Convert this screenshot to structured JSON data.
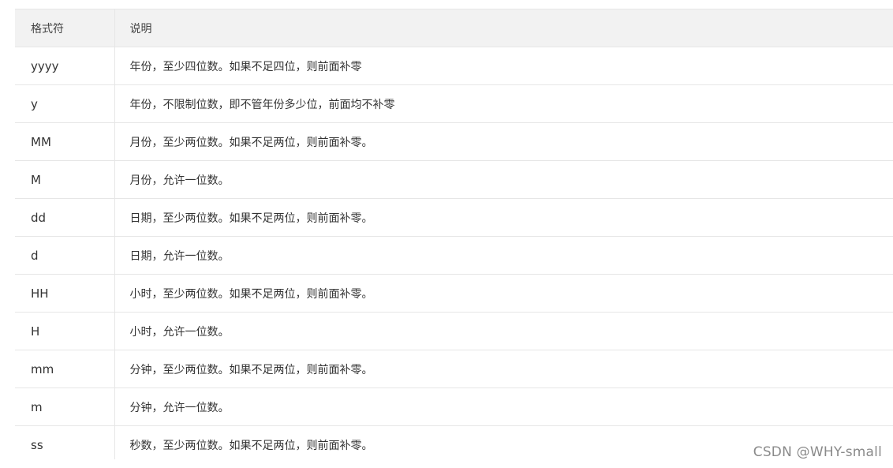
{
  "table": {
    "headers": [
      "格式符",
      "说明"
    ],
    "rows": [
      {
        "format": "yyyy",
        "desc": "年份，至少四位数。如果不足四位，则前面补零"
      },
      {
        "format": "y",
        "desc": "年份，不限制位数，即不管年份多少位，前面均不补零"
      },
      {
        "format": "MM",
        "desc": "月份，至少两位数。如果不足两位，则前面补零。"
      },
      {
        "format": "M",
        "desc": "月份，允许一位数。"
      },
      {
        "format": "dd",
        "desc": "日期，至少两位数。如果不足两位，则前面补零。"
      },
      {
        "format": "d",
        "desc": "日期，允许一位数。"
      },
      {
        "format": "HH",
        "desc": "小时，至少两位数。如果不足两位，则前面补零。"
      },
      {
        "format": "H",
        "desc": "小时，允许一位数。"
      },
      {
        "format": "mm",
        "desc": "分钟，至少两位数。如果不足两位，则前面补零。"
      },
      {
        "format": "m",
        "desc": "分钟，允许一位数。"
      },
      {
        "format": "ss",
        "desc": "秒数，至少两位数。如果不足两位，则前面补零。"
      }
    ]
  },
  "watermark": "CSDN @WHY-small"
}
